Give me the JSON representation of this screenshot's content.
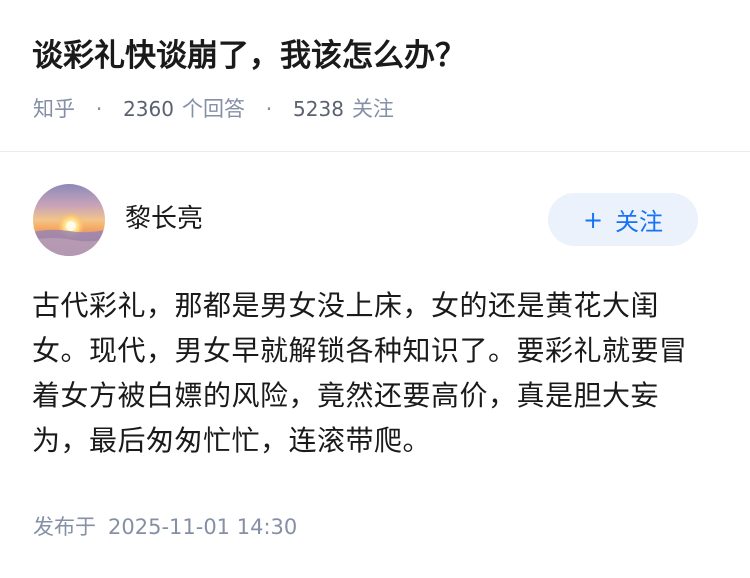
{
  "question": {
    "title": "谈彩礼快谈崩了，我该怎么办？",
    "source": "知乎",
    "separator": "·",
    "answer_count": "2360",
    "answer_unit": "个回答",
    "follower_count": "5238",
    "follower_unit": "关注"
  },
  "author": {
    "name": "黎长亮",
    "avatar_icon": "sunset-avatar-image"
  },
  "follow_button": {
    "icon": "plus-icon",
    "plus": "+",
    "label": "关注"
  },
  "answer": {
    "content": "古代彩礼，那都是男女没上床，女的还是黄花大闺女。现代，男女早就解锁各种知识了。要彩礼就要冒着女方被白嫖的风险，竟然还要高价，真是胆大妄为，最后匆匆忙忙，连滚带爬。"
  },
  "publish": {
    "label": "发布于",
    "time": "2025-11-01 14:30"
  },
  "colors": {
    "accent": "#1772f6",
    "accent_bg": "#ebf2fb",
    "meta_gray": "#8590a6",
    "text": "#1a1a1a"
  }
}
